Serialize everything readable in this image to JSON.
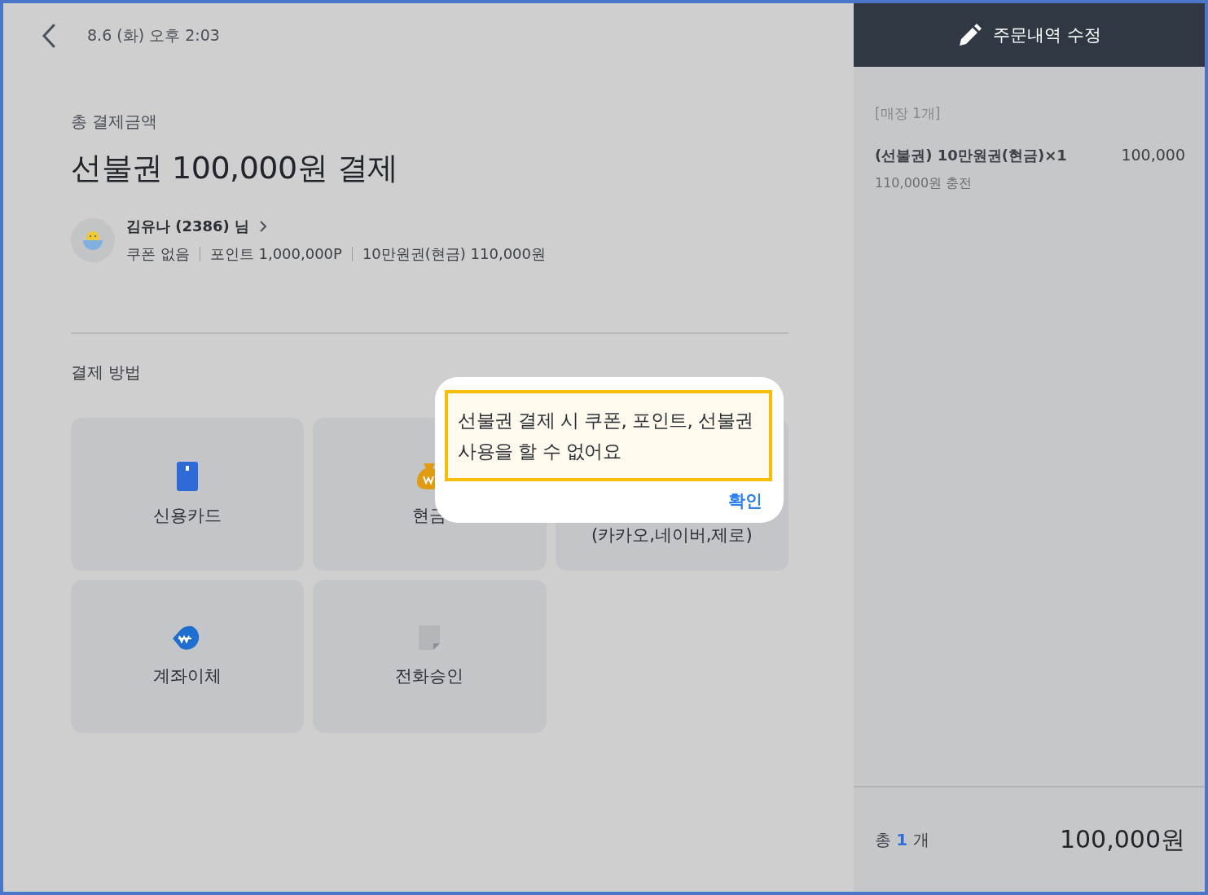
{
  "header": {
    "datetime": "8.6 (화) 오후 2:03"
  },
  "summary": {
    "label": "총 결제금액",
    "headline": "선불권 100,000원 결제"
  },
  "customer": {
    "name": "김유나 (2386) 님",
    "details": [
      "쿠폰 없음",
      "포인트 1,000,000P",
      "10만원권(현금) 110,000원"
    ]
  },
  "payment": {
    "title": "결제 방법",
    "methods": [
      {
        "kind": "card",
        "label": "신용카드"
      },
      {
        "kind": "cash",
        "label": "현금"
      },
      {
        "kind": "qr",
        "label": "(카카오,네이버,제로)"
      },
      {
        "kind": "transfer",
        "label": "계좌이체"
      },
      {
        "kind": "phone",
        "label": "전화승인"
      }
    ]
  },
  "order": {
    "edit_button": "주문내역 수정",
    "group": "[매장 1개]",
    "items": [
      {
        "name": "(선불권) 10만원권(현금)×1",
        "price": "100,000",
        "note": "110,000원 충전"
      }
    ],
    "total": {
      "label": "총",
      "count": "1",
      "unit": "개",
      "amount": "100,000원"
    }
  },
  "dialog": {
    "message": "선불권 결제 시 쿠폰, 포인트, 선불권 사용을 할 수 없어요",
    "confirm": "확인"
  }
}
